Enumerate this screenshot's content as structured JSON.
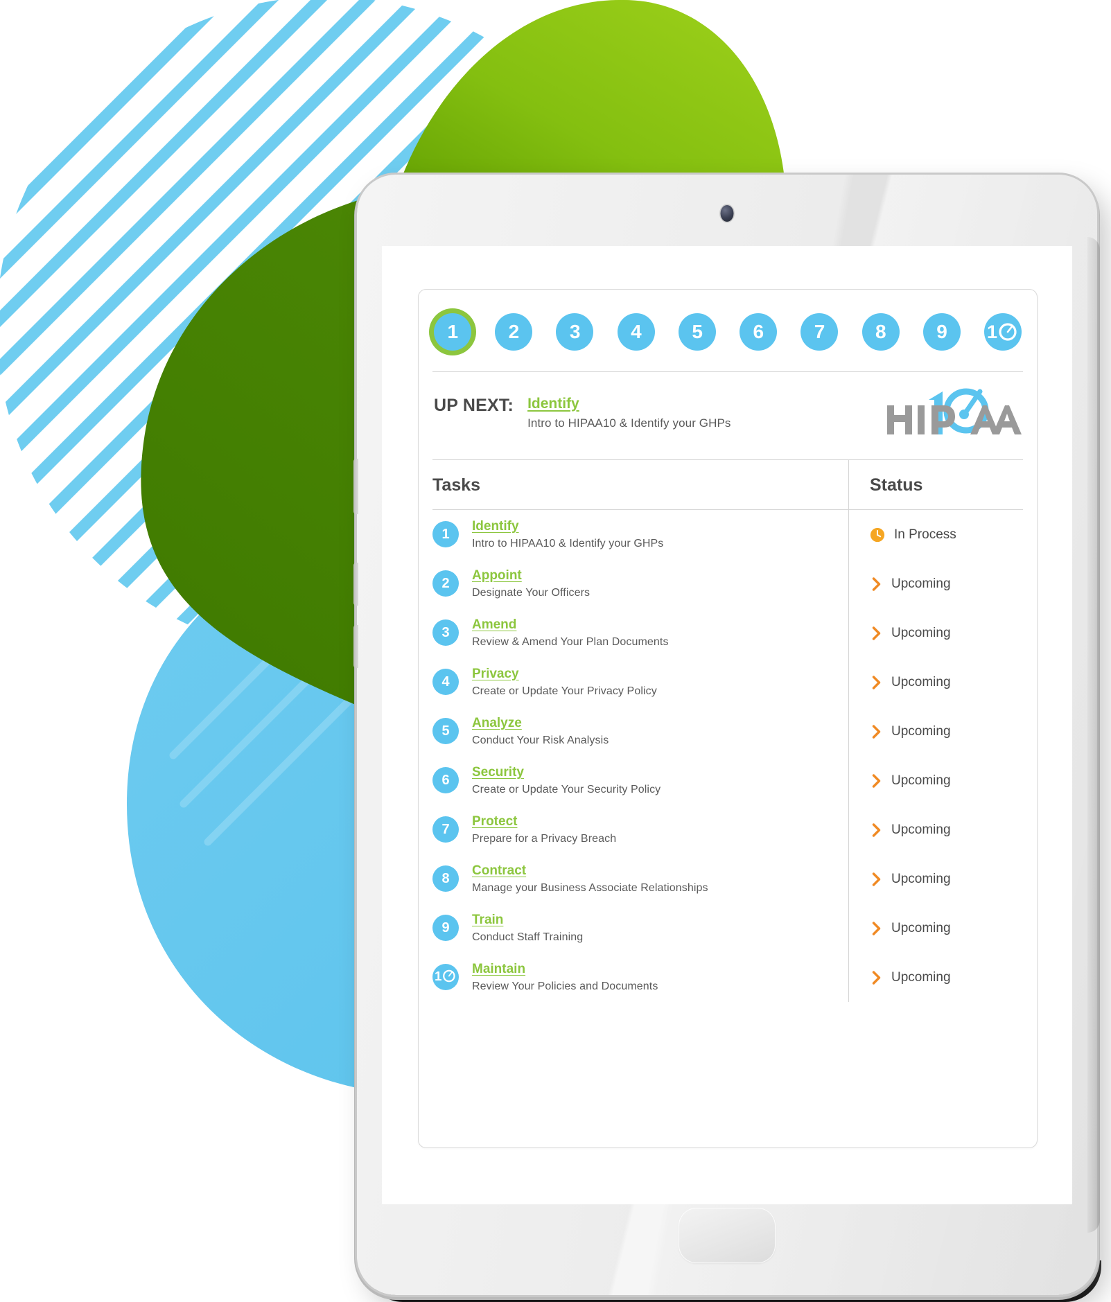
{
  "colors": {
    "accent_blue": "#5bc4ef",
    "accent_green": "#8cc63e",
    "status_orange": "#f5a623",
    "text_dark": "#4a4a4a",
    "text_body": "#5a5a5a",
    "logo_gray": "#9a9a9a"
  },
  "stepper": {
    "steps": [
      "1",
      "2",
      "3",
      "4",
      "5",
      "6",
      "7",
      "8",
      "9",
      "10"
    ],
    "active_index": 0
  },
  "up_next": {
    "label": "UP NEXT:",
    "title": "Identify",
    "subtitle": "Intro to HIPAA10 & Identify your GHPs",
    "logo_text": "HIPAA",
    "logo_badge": "10"
  },
  "table": {
    "headers": {
      "tasks": "Tasks",
      "status": "Status"
    },
    "rows": [
      {
        "num": "1",
        "title": "Identify",
        "subtitle": "Intro to HIPAA10 & Identify your GHPs",
        "status": "In Process",
        "status_icon": "clock-icon"
      },
      {
        "num": "2",
        "title": "Appoint",
        "subtitle": "Designate Your Officers",
        "status": "Upcoming",
        "status_icon": "chevron-right-icon"
      },
      {
        "num": "3",
        "title": "Amend",
        "subtitle": "Review & Amend Your Plan Documents",
        "status": "Upcoming",
        "status_icon": "chevron-right-icon"
      },
      {
        "num": "4",
        "title": "Privacy",
        "subtitle": "Create or Update Your Privacy Policy",
        "status": "Upcoming",
        "status_icon": "chevron-right-icon"
      },
      {
        "num": "5",
        "title": "Analyze",
        "subtitle": "Conduct Your Risk Analysis",
        "status": "Upcoming",
        "status_icon": "chevron-right-icon"
      },
      {
        "num": "6",
        "title": "Security",
        "subtitle": "Create or Update Your Security Policy",
        "status": "Upcoming",
        "status_icon": "chevron-right-icon"
      },
      {
        "num": "7",
        "title": "Protect",
        "subtitle": "Prepare for a Privacy Breach",
        "status": "Upcoming",
        "status_icon": "chevron-right-icon"
      },
      {
        "num": "8",
        "title": "Contract",
        "subtitle": "Manage your Business Associate Relationships",
        "status": "Upcoming",
        "status_icon": "chevron-right-icon"
      },
      {
        "num": "9",
        "title": "Train",
        "subtitle": "Conduct Staff Training",
        "status": "Upcoming",
        "status_icon": "chevron-right-icon"
      },
      {
        "num": "10",
        "title": "Maintain",
        "subtitle": "Review Your Policies and Documents",
        "status": "Upcoming",
        "status_icon": "chevron-right-icon"
      }
    ]
  }
}
